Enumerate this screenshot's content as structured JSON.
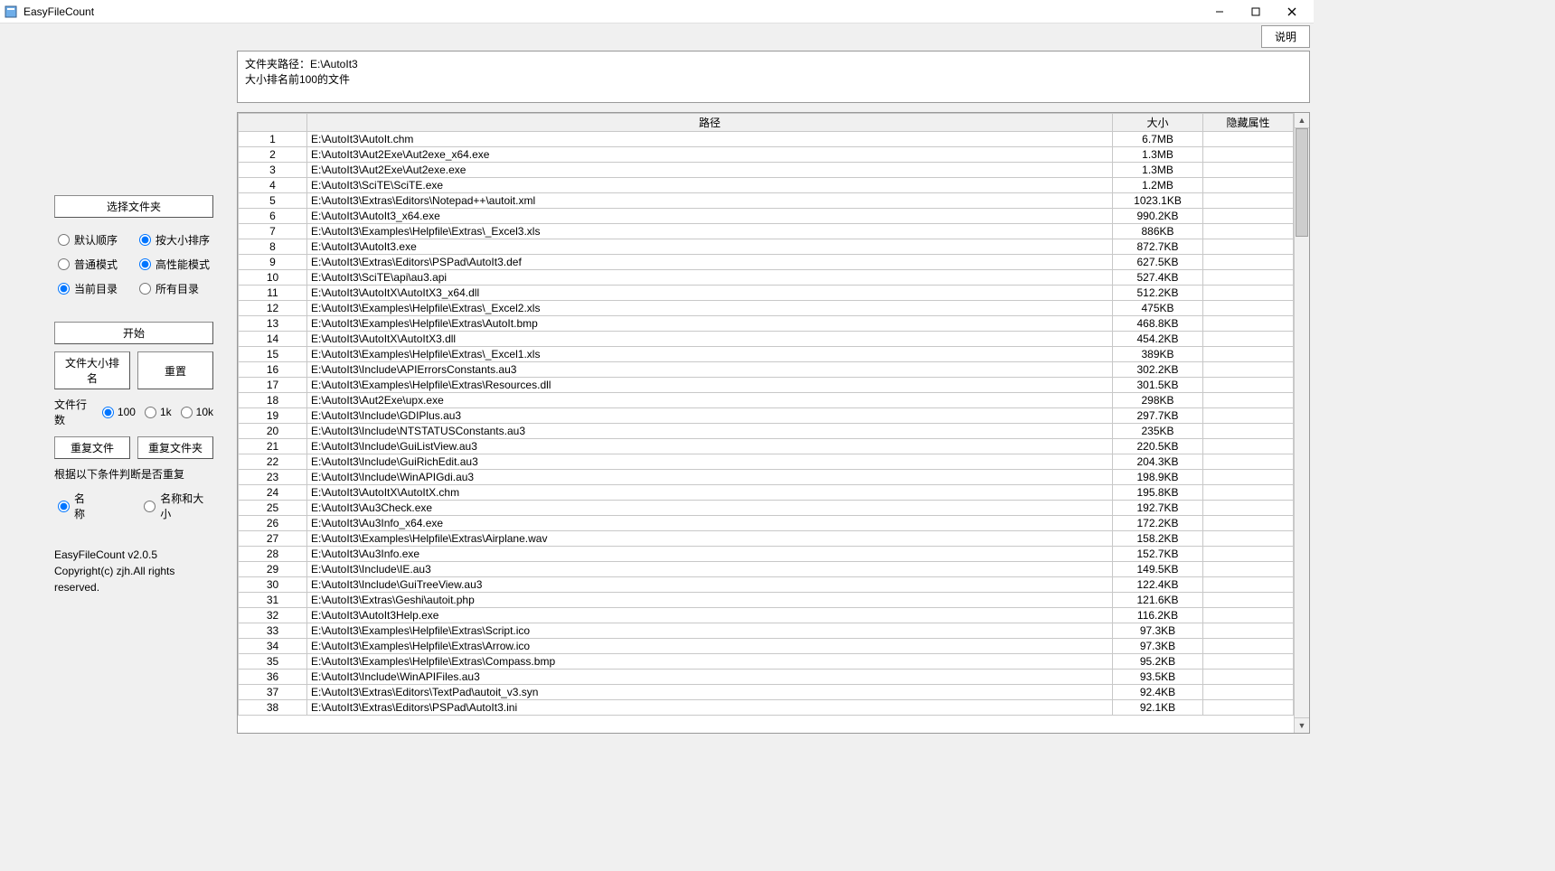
{
  "window": {
    "title": "EasyFileCount"
  },
  "toolbar": {
    "help": "说明"
  },
  "sidebar": {
    "select_folder": "选择文件夹",
    "sort_default": "默认顺序",
    "sort_size": "按大小排序",
    "mode_normal": "普通模式",
    "mode_perf": "高性能模式",
    "dir_current": "当前目录",
    "dir_all": "所有目录",
    "start": "开始",
    "rank_size": "文件大小排名",
    "reset": "重置",
    "rows_label": "文件行数",
    "rows_100": "100",
    "rows_1k": "1k",
    "rows_10k": "10k",
    "dup_files": "重复文件",
    "dup_folders": "重复文件夹",
    "dup_cond_label": "根据以下条件判断是否重复",
    "cond_name": "名称",
    "cond_name_size": "名称和大小",
    "version": "EasyFileCount v2.0.5",
    "copyright": "Copyright(c) zjh.All rights reserved."
  },
  "info": {
    "line1": "文件夹路径：E:\\AutoIt3",
    "line2": "大小排名前100的文件"
  },
  "table": {
    "headers": {
      "path": "路径",
      "size": "大小",
      "hidden": "隐藏属性"
    },
    "rows": [
      {
        "idx": 1,
        "path": "E:\\AutoIt3\\AutoIt.chm",
        "size": "6.7MB",
        "hidden": ""
      },
      {
        "idx": 2,
        "path": "E:\\AutoIt3\\Aut2Exe\\Aut2exe_x64.exe",
        "size": "1.3MB",
        "hidden": ""
      },
      {
        "idx": 3,
        "path": "E:\\AutoIt3\\Aut2Exe\\Aut2exe.exe",
        "size": "1.3MB",
        "hidden": ""
      },
      {
        "idx": 4,
        "path": "E:\\AutoIt3\\SciTE\\SciTE.exe",
        "size": "1.2MB",
        "hidden": ""
      },
      {
        "idx": 5,
        "path": "E:\\AutoIt3\\Extras\\Editors\\Notepad++\\autoit.xml",
        "size": "1023.1KB",
        "hidden": ""
      },
      {
        "idx": 6,
        "path": "E:\\AutoIt3\\AutoIt3_x64.exe",
        "size": "990.2KB",
        "hidden": ""
      },
      {
        "idx": 7,
        "path": "E:\\AutoIt3\\Examples\\Helpfile\\Extras\\_Excel3.xls",
        "size": "886KB",
        "hidden": ""
      },
      {
        "idx": 8,
        "path": "E:\\AutoIt3\\AutoIt3.exe",
        "size": "872.7KB",
        "hidden": ""
      },
      {
        "idx": 9,
        "path": "E:\\AutoIt3\\Extras\\Editors\\PSPad\\AutoIt3.def",
        "size": "627.5KB",
        "hidden": ""
      },
      {
        "idx": 10,
        "path": "E:\\AutoIt3\\SciTE\\api\\au3.api",
        "size": "527.4KB",
        "hidden": ""
      },
      {
        "idx": 11,
        "path": "E:\\AutoIt3\\AutoItX\\AutoItX3_x64.dll",
        "size": "512.2KB",
        "hidden": ""
      },
      {
        "idx": 12,
        "path": "E:\\AutoIt3\\Examples\\Helpfile\\Extras\\_Excel2.xls",
        "size": "475KB",
        "hidden": ""
      },
      {
        "idx": 13,
        "path": "E:\\AutoIt3\\Examples\\Helpfile\\Extras\\AutoIt.bmp",
        "size": "468.8KB",
        "hidden": ""
      },
      {
        "idx": 14,
        "path": "E:\\AutoIt3\\AutoItX\\AutoItX3.dll",
        "size": "454.2KB",
        "hidden": ""
      },
      {
        "idx": 15,
        "path": "E:\\AutoIt3\\Examples\\Helpfile\\Extras\\_Excel1.xls",
        "size": "389KB",
        "hidden": ""
      },
      {
        "idx": 16,
        "path": "E:\\AutoIt3\\Include\\APIErrorsConstants.au3",
        "size": "302.2KB",
        "hidden": ""
      },
      {
        "idx": 17,
        "path": "E:\\AutoIt3\\Examples\\Helpfile\\Extras\\Resources.dll",
        "size": "301.5KB",
        "hidden": ""
      },
      {
        "idx": 18,
        "path": "E:\\AutoIt3\\Aut2Exe\\upx.exe",
        "size": "298KB",
        "hidden": ""
      },
      {
        "idx": 19,
        "path": "E:\\AutoIt3\\Include\\GDIPlus.au3",
        "size": "297.7KB",
        "hidden": ""
      },
      {
        "idx": 20,
        "path": "E:\\AutoIt3\\Include\\NTSTATUSConstants.au3",
        "size": "235KB",
        "hidden": ""
      },
      {
        "idx": 21,
        "path": "E:\\AutoIt3\\Include\\GuiListView.au3",
        "size": "220.5KB",
        "hidden": ""
      },
      {
        "idx": 22,
        "path": "E:\\AutoIt3\\Include\\GuiRichEdit.au3",
        "size": "204.3KB",
        "hidden": ""
      },
      {
        "idx": 23,
        "path": "E:\\AutoIt3\\Include\\WinAPIGdi.au3",
        "size": "198.9KB",
        "hidden": ""
      },
      {
        "idx": 24,
        "path": "E:\\AutoIt3\\AutoItX\\AutoItX.chm",
        "size": "195.8KB",
        "hidden": ""
      },
      {
        "idx": 25,
        "path": "E:\\AutoIt3\\Au3Check.exe",
        "size": "192.7KB",
        "hidden": ""
      },
      {
        "idx": 26,
        "path": "E:\\AutoIt3\\Au3Info_x64.exe",
        "size": "172.2KB",
        "hidden": ""
      },
      {
        "idx": 27,
        "path": "E:\\AutoIt3\\Examples\\Helpfile\\Extras\\Airplane.wav",
        "size": "158.2KB",
        "hidden": ""
      },
      {
        "idx": 28,
        "path": "E:\\AutoIt3\\Au3Info.exe",
        "size": "152.7KB",
        "hidden": ""
      },
      {
        "idx": 29,
        "path": "E:\\AutoIt3\\Include\\IE.au3",
        "size": "149.5KB",
        "hidden": ""
      },
      {
        "idx": 30,
        "path": "E:\\AutoIt3\\Include\\GuiTreeView.au3",
        "size": "122.4KB",
        "hidden": ""
      },
      {
        "idx": 31,
        "path": "E:\\AutoIt3\\Extras\\Geshi\\autoit.php",
        "size": "121.6KB",
        "hidden": ""
      },
      {
        "idx": 32,
        "path": "E:\\AutoIt3\\AutoIt3Help.exe",
        "size": "116.2KB",
        "hidden": ""
      },
      {
        "idx": 33,
        "path": "E:\\AutoIt3\\Examples\\Helpfile\\Extras\\Script.ico",
        "size": "97.3KB",
        "hidden": ""
      },
      {
        "idx": 34,
        "path": "E:\\AutoIt3\\Examples\\Helpfile\\Extras\\Arrow.ico",
        "size": "97.3KB",
        "hidden": ""
      },
      {
        "idx": 35,
        "path": "E:\\AutoIt3\\Examples\\Helpfile\\Extras\\Compass.bmp",
        "size": "95.2KB",
        "hidden": ""
      },
      {
        "idx": 36,
        "path": "E:\\AutoIt3\\Include\\WinAPIFiles.au3",
        "size": "93.5KB",
        "hidden": ""
      },
      {
        "idx": 37,
        "path": "E:\\AutoIt3\\Extras\\Editors\\TextPad\\autoit_v3.syn",
        "size": "92.4KB",
        "hidden": ""
      },
      {
        "idx": 38,
        "path": "E:\\AutoIt3\\Extras\\Editors\\PSPad\\AutoIt3.ini",
        "size": "92.1KB",
        "hidden": ""
      }
    ]
  }
}
